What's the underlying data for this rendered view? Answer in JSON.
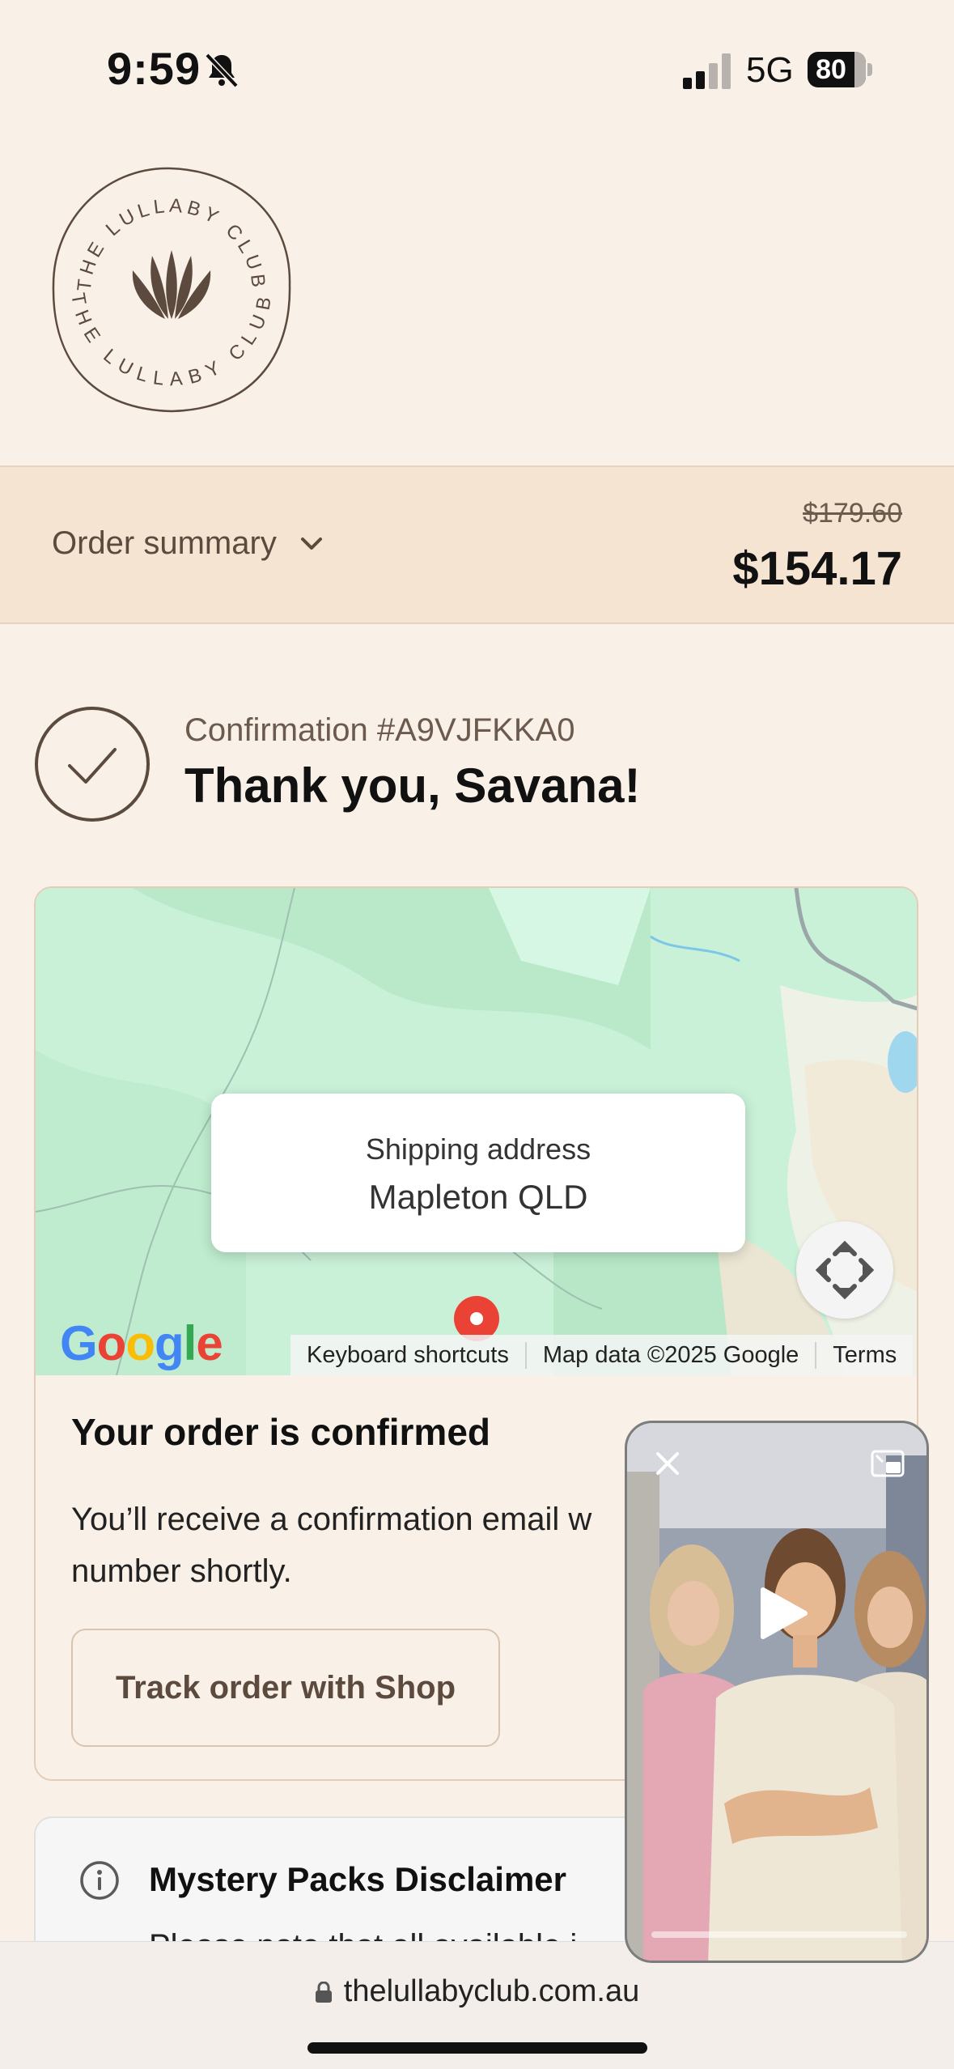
{
  "status_bar": {
    "time": "9:59",
    "network": "5G",
    "battery": "80",
    "battery_level": 0.8
  },
  "brand": {
    "logo_text": "THE LULLABY CLUB"
  },
  "order_summary": {
    "toggle_label": "Order summary",
    "original_price": "$179.60",
    "total_price": "$154.17"
  },
  "confirmation": {
    "number": "Confirmation #A9VJFKKA0",
    "heading": "Thank you, Savana!"
  },
  "map": {
    "shipping_label": "Shipping address",
    "shipping_address": "Mapleton QLD",
    "google_logo": "Google",
    "keyboard_shortcuts": "Keyboard shortcuts",
    "map_data": "Map data ©2025 Google",
    "terms": "Terms"
  },
  "order_status": {
    "title": "Your order is confirmed",
    "line1": "You’ll receive a confirmation email w",
    "line2": "number shortly.",
    "track_button": "Track order with Shop"
  },
  "disclaimer": {
    "title": "Mystery Packs Disclaimer",
    "body": "Please note that all available i"
  },
  "browser": {
    "url": "thelullabyclub.com.au"
  },
  "icons": {
    "bell": "bell-slash-icon",
    "check": "checkmark-circle-icon",
    "info": "info-icon",
    "lock": "lock-icon",
    "close": "close-icon",
    "pip": "picture-in-picture-icon",
    "play": "play-icon",
    "fullscreen": "fullscreen-arrows-icon",
    "pin": "map-pin-icon"
  },
  "colors": {
    "background": "#f9f0e7",
    "summary_bar": "#f5e4d2",
    "brand_brown": "#5b4a3d",
    "map_green": "#cdf3dc",
    "pin_red": "#ea4335"
  }
}
